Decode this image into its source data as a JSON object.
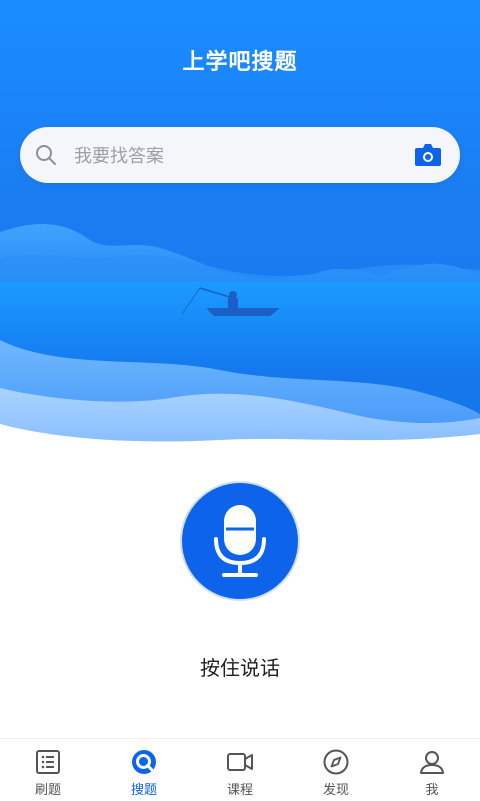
{
  "header": {
    "title": "上学吧搜题"
  },
  "search": {
    "placeholder": "我要找答案"
  },
  "voice": {
    "label": "按住说话"
  },
  "tabs": [
    {
      "label": "刷题",
      "icon": "list-icon"
    },
    {
      "label": "搜题",
      "icon": "search-tab-icon",
      "active": true
    },
    {
      "label": "课程",
      "icon": "video-icon"
    },
    {
      "label": "发现",
      "icon": "compass-icon"
    },
    {
      "label": "我",
      "icon": "user-icon"
    }
  ],
  "colors": {
    "primary": "#0d63ea",
    "hero": "#1a8dff"
  }
}
